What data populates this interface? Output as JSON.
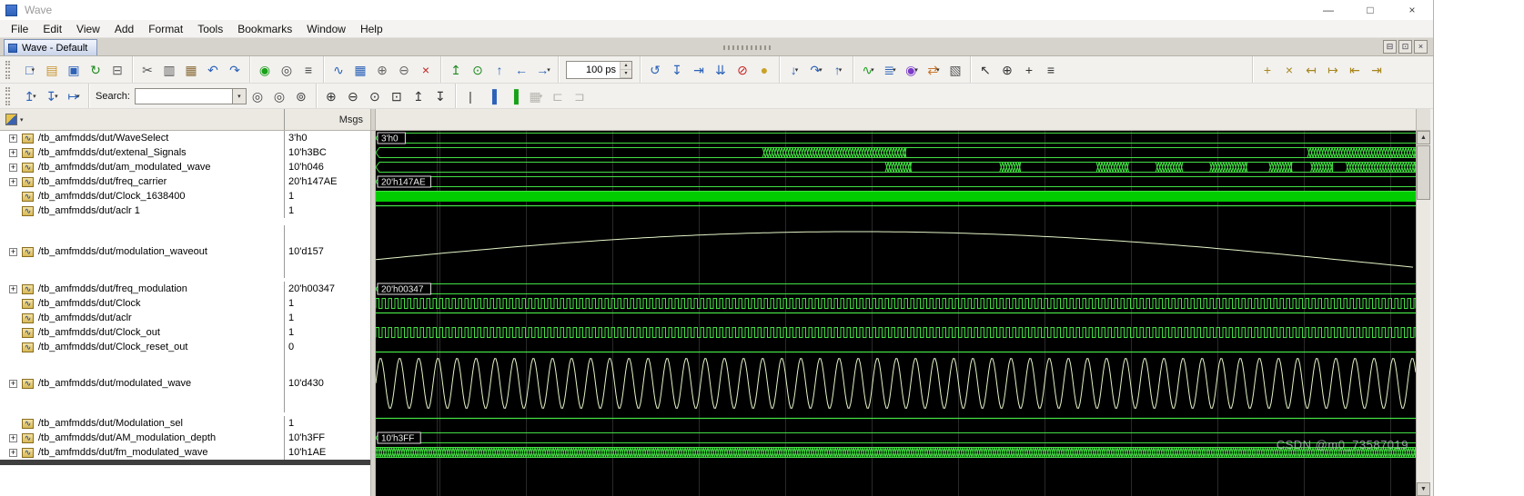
{
  "window": {
    "title": "Wave",
    "controls": [
      {
        "name": "minimize-button",
        "glyph": "—"
      },
      {
        "name": "maximize-button",
        "glyph": "□"
      },
      {
        "name": "close-button",
        "glyph": "×"
      }
    ]
  },
  "menubar": {
    "items": [
      "File",
      "Edit",
      "View",
      "Add",
      "Format",
      "Tools",
      "Bookmarks",
      "Window",
      "Help"
    ]
  },
  "tabbar": {
    "active_tab": "Wave - Default",
    "pane_buttons": [
      {
        "name": "pane-minimize-button",
        "glyph": "⊟"
      },
      {
        "name": "pane-maximize-button",
        "glyph": "⊡"
      },
      {
        "name": "pane-close-button",
        "glyph": "×"
      }
    ]
  },
  "toolbar_main": {
    "time_value": "100 ps",
    "groups": [
      {
        "name": "file",
        "items": [
          {
            "name": "new-file-button",
            "glyph": "□",
            "color": "#2c62b8",
            "caret": true
          },
          {
            "name": "open-file-button",
            "glyph": "▤",
            "color": "#c9952f"
          },
          {
            "name": "save-button",
            "glyph": "▣",
            "color": "#2c62b8"
          },
          {
            "name": "reload-button",
            "glyph": "↻",
            "color": "#1f8a1f"
          },
          {
            "name": "print-button",
            "glyph": "⊟",
            "color": "#666666"
          }
        ]
      },
      {
        "name": "edit",
        "items": [
          {
            "name": "cut-button",
            "glyph": "✂",
            "color": "#555555"
          },
          {
            "name": "copy-button",
            "glyph": "▥",
            "color": "#555555"
          },
          {
            "name": "paste-button",
            "glyph": "▦",
            "color": "#8a6d3b"
          },
          {
            "name": "undo-button",
            "glyph": "↶",
            "color": "#2c62b8"
          },
          {
            "name": "redo-button",
            "glyph": "↷",
            "color": "#2c62b8"
          }
        ]
      },
      {
        "name": "find",
        "items": [
          {
            "name": "compile-button",
            "glyph": "◉",
            "color": "#18a018"
          },
          {
            "name": "find-button",
            "glyph": "◎",
            "color": "#444444"
          },
          {
            "name": "environment-button",
            "glyph": "≡",
            "color": "#444444"
          }
        ]
      },
      {
        "name": "wave-edit",
        "items": [
          {
            "name": "insert-wave-button",
            "glyph": "∿",
            "color": "#2c62b8"
          },
          {
            "name": "edit-grid-button",
            "glyph": "▦",
            "color": "#2c62b8"
          },
          {
            "name": "combine-signals-button",
            "glyph": "⊕",
            "color": "#666666"
          },
          {
            "name": "split-signals-button",
            "glyph": "⊖",
            "color": "#666666"
          },
          {
            "name": "delete-button",
            "glyph": "×",
            "color": "#c42222"
          }
        ]
      },
      {
        "name": "navigate",
        "items": [
          {
            "name": "goto-first-button",
            "glyph": "↥",
            "color": "#1f8a1f"
          },
          {
            "name": "goto-context-button",
            "glyph": "⊙",
            "color": "#1f8a1f"
          },
          {
            "name": "up-context-button",
            "glyph": "↑",
            "color": "#2c62b8"
          },
          {
            "name": "back-button",
            "glyph": "←",
            "color": "#2c62b8"
          },
          {
            "name": "forward-button",
            "glyph": "→",
            "color": "#2c62b8",
            "caret": true
          }
        ]
      },
      {
        "name": "run-time",
        "items": [
          {
            "type": "time",
            "name": "time-input"
          }
        ]
      },
      {
        "name": "run",
        "items": [
          {
            "name": "restart-button",
            "glyph": "↺",
            "color": "#2c62b8"
          },
          {
            "name": "run-button",
            "glyph": "↧",
            "color": "#2c62b8"
          },
          {
            "name": "continue-run-button",
            "glyph": "⇥",
            "color": "#2c62b8"
          },
          {
            "name": "run-all-button",
            "glyph": "⇊",
            "color": "#2c62b8"
          },
          {
            "name": "break-button",
            "glyph": "⊘",
            "color": "#c42222"
          },
          {
            "name": "stop-hand-button",
            "glyph": "●",
            "color": "#c9a227"
          }
        ]
      },
      {
        "name": "step",
        "items": [
          {
            "name": "step-into-button",
            "glyph": "↓",
            "color": "#2c62b8",
            "caret": true
          },
          {
            "name": "step-over-button",
            "glyph": "↷",
            "color": "#2c62b8",
            "caret": true
          },
          {
            "name": "step-out-button",
            "glyph": "↑",
            "color": "#2c62b8",
            "caret": true
          }
        ]
      },
      {
        "name": "add",
        "items": [
          {
            "name": "add-to-wave-button",
            "glyph": "∿",
            "color": "#18a018",
            "caret": true
          },
          {
            "name": "add-to-list-button",
            "glyph": "≣",
            "color": "#2c62b8",
            "caret": true
          },
          {
            "name": "add-to-log-button",
            "glyph": "◉",
            "color": "#7a3bc9",
            "caret": true
          },
          {
            "name": "add-to-dataflow-button",
            "glyph": "⇄",
            "color": "#c9762a",
            "caret": true
          },
          {
            "name": "show-dataflow-button",
            "glyph": "▧",
            "color": "#555555"
          }
        ]
      },
      {
        "name": "modes",
        "items": [
          {
            "name": "select-mode-button",
            "glyph": "↖",
            "color": "#333333"
          },
          {
            "name": "zoom-mode-button",
            "glyph": "⊕",
            "color": "#333333"
          },
          {
            "name": "pan-mode-button",
            "glyph": "+",
            "color": "#333333"
          },
          {
            "name": "edit-mode-button",
            "glyph": "≡",
            "color": "#333333"
          }
        ]
      },
      {
        "name": "cursors",
        "right": true,
        "items": [
          {
            "name": "insert-cursor-button",
            "glyph": "+",
            "color": "#a8861e"
          },
          {
            "name": "delete-cursor-button",
            "glyph": "×",
            "color": "#a8861e"
          },
          {
            "name": "prev-transition-button",
            "glyph": "↤",
            "color": "#a8861e"
          },
          {
            "name": "next-transition-button",
            "glyph": "↦",
            "color": "#a8861e"
          },
          {
            "name": "prev-edge-button",
            "glyph": "⇤",
            "color": "#a8861e"
          },
          {
            "name": "next-edge-button",
            "glyph": "⇥",
            "color": "#a8861e"
          }
        ]
      }
    ]
  },
  "toolbar_wave": {
    "search_label": "Search:",
    "search_value": "",
    "groups": [
      {
        "name": "events",
        "items": [
          {
            "name": "show-drivers-button",
            "glyph": "↥",
            "color": "#2c62b8",
            "caret": true
          },
          {
            "name": "show-readers-button",
            "glyph": "↧",
            "color": "#2c62b8",
            "caret": true
          },
          {
            "name": "follow-event-button",
            "glyph": "↦",
            "color": "#2c62b8",
            "caret": true
          }
        ]
      },
      {
        "name": "search",
        "items": [
          {
            "type": "search"
          },
          {
            "name": "find-previous-button",
            "glyph": "◎",
            "color": "#444444"
          },
          {
            "name": "find-next-button",
            "glyph": "◎",
            "color": "#444444"
          },
          {
            "name": "search-options-button",
            "glyph": "⊚",
            "color": "#444444"
          }
        ]
      },
      {
        "name": "zoom",
        "items": [
          {
            "name": "zoom-in-button",
            "glyph": "⊕",
            "color": "#333333"
          },
          {
            "name": "zoom-out-button",
            "glyph": "⊖",
            "color": "#333333"
          },
          {
            "name": "zoom-full-button",
            "glyph": "⊙",
            "color": "#333333"
          },
          {
            "name": "zoom-range-button",
            "glyph": "⊡",
            "color": "#333333"
          },
          {
            "name": "zoom-cursor-button",
            "glyph": "↥",
            "color": "#333333"
          },
          {
            "name": "zoom-last-button",
            "glyph": "↧",
            "color": "#333333"
          }
        ]
      },
      {
        "name": "display",
        "items": [
          {
            "name": "format-literal-button",
            "glyph": "|",
            "color": "#333333"
          },
          {
            "name": "format-logic-button",
            "glyph": "▐",
            "color": "#2c62b8"
          },
          {
            "name": "format-analog-button",
            "glyph": "▐",
            "color": "#18a018"
          },
          {
            "name": "grid-options-button",
            "glyph": "▦",
            "color": "#999999",
            "caret": true,
            "disabled": true
          },
          {
            "name": "expand-groups-button",
            "glyph": "⊏",
            "color": "#aaaaaa",
            "disabled": true
          },
          {
            "name": "collapse-groups-button",
            "glyph": "⊐",
            "color": "#aaaaaa",
            "disabled": true
          }
        ]
      }
    ]
  },
  "wave": {
    "msgs_header": "Msgs",
    "colors": {
      "trace": "#44e044",
      "solid_fill": "#00cc00",
      "analog": "#e3f4c7",
      "label": "#f0f0f0",
      "background": "#000000",
      "grid": "#292929"
    },
    "signals": [
      {
        "name": "/tb_amfmdds/dut/WaveSelect",
        "value": "3'h0",
        "expandable": true,
        "kind": "bus",
        "label": "3'h0",
        "height": 16
      },
      {
        "name": "/tb_amfmdds/dut/extenal_Signals",
        "value": "10'h3BC",
        "expandable": true,
        "kind": "bus",
        "label": "",
        "height": 16,
        "busy": [
          [
            0.372,
            0.51
          ],
          [
            0.896,
            1.0
          ]
        ]
      },
      {
        "name": "/tb_amfmdds/dut/am_modulated_wave",
        "value": "10'h046",
        "expandable": true,
        "kind": "bus",
        "label": "",
        "height": 16,
        "busy": [
          [
            0.49,
            0.515
          ],
          [
            0.6,
            0.62
          ],
          [
            0.693,
            0.724
          ],
          [
            0.75,
            0.776
          ],
          [
            0.802,
            0.838
          ],
          [
            0.859,
            0.881
          ],
          [
            0.899,
            0.92
          ],
          [
            0.933,
            1.0
          ]
        ]
      },
      {
        "name": "/tb_amfmdds/dut/freq_carrier",
        "value": "20'h147AE",
        "expandable": true,
        "kind": "bus",
        "label": "20'h147AE",
        "height": 16
      },
      {
        "name": "/tb_amfmdds/dut/Clock_1638400",
        "value": "1",
        "expandable": false,
        "kind": "fill",
        "height": 16
      },
      {
        "name": "/tb_amfmdds/dut/aclr 1",
        "value": "1",
        "expandable": false,
        "kind": "high",
        "height": 16
      },
      {
        "kind": "spacer",
        "height": 8
      },
      {
        "name": "/tb_amfmdds/dut/modulation_waveout",
        "value": "10'd157",
        "expandable": true,
        "kind": "analog_slow",
        "height": 58
      },
      {
        "kind": "spacer",
        "height": 4
      },
      {
        "name": "/tb_amfmdds/dut/freq_modulation",
        "value": "20'h00347",
        "expandable": true,
        "kind": "bus",
        "label": "20'h00347",
        "height": 16
      },
      {
        "name": "/tb_amfmdds/dut/Clock",
        "value": "1",
        "expandable": false,
        "kind": "clock",
        "height": 16
      },
      {
        "name": "/tb_amfmdds/dut/aclr",
        "value": "1",
        "expandable": false,
        "kind": "high",
        "height": 16
      },
      {
        "name": "/tb_amfmdds/dut/Clock_out",
        "value": "1",
        "expandable": false,
        "kind": "clock",
        "height": 16
      },
      {
        "name": "/tb_amfmdds/dut/Clock_reset_out",
        "value": "0",
        "expandable": false,
        "kind": "low",
        "height": 16
      },
      {
        "name": "/tb_amfmdds/dut/modulated_wave",
        "value": "10'd430",
        "expandable": true,
        "kind": "analog_fast",
        "height": 64
      },
      {
        "kind": "spacer",
        "height": 4
      },
      {
        "name": "/tb_amfmdds/dut/Modulation_sel",
        "value": "1",
        "expandable": false,
        "kind": "high",
        "height": 16
      },
      {
        "name": "/tb_amfmdds/dut/AM_modulation_depth",
        "value": "10'h3FF",
        "expandable": true,
        "kind": "bus",
        "label": "10'h3FF",
        "height": 16
      },
      {
        "name": "/tb_amfmdds/dut/fm_modulated_wave",
        "value": "10'h1AE",
        "expandable": true,
        "kind": "busy_full",
        "height": 16
      }
    ]
  },
  "watermark": "CSDN @m0_73587019"
}
